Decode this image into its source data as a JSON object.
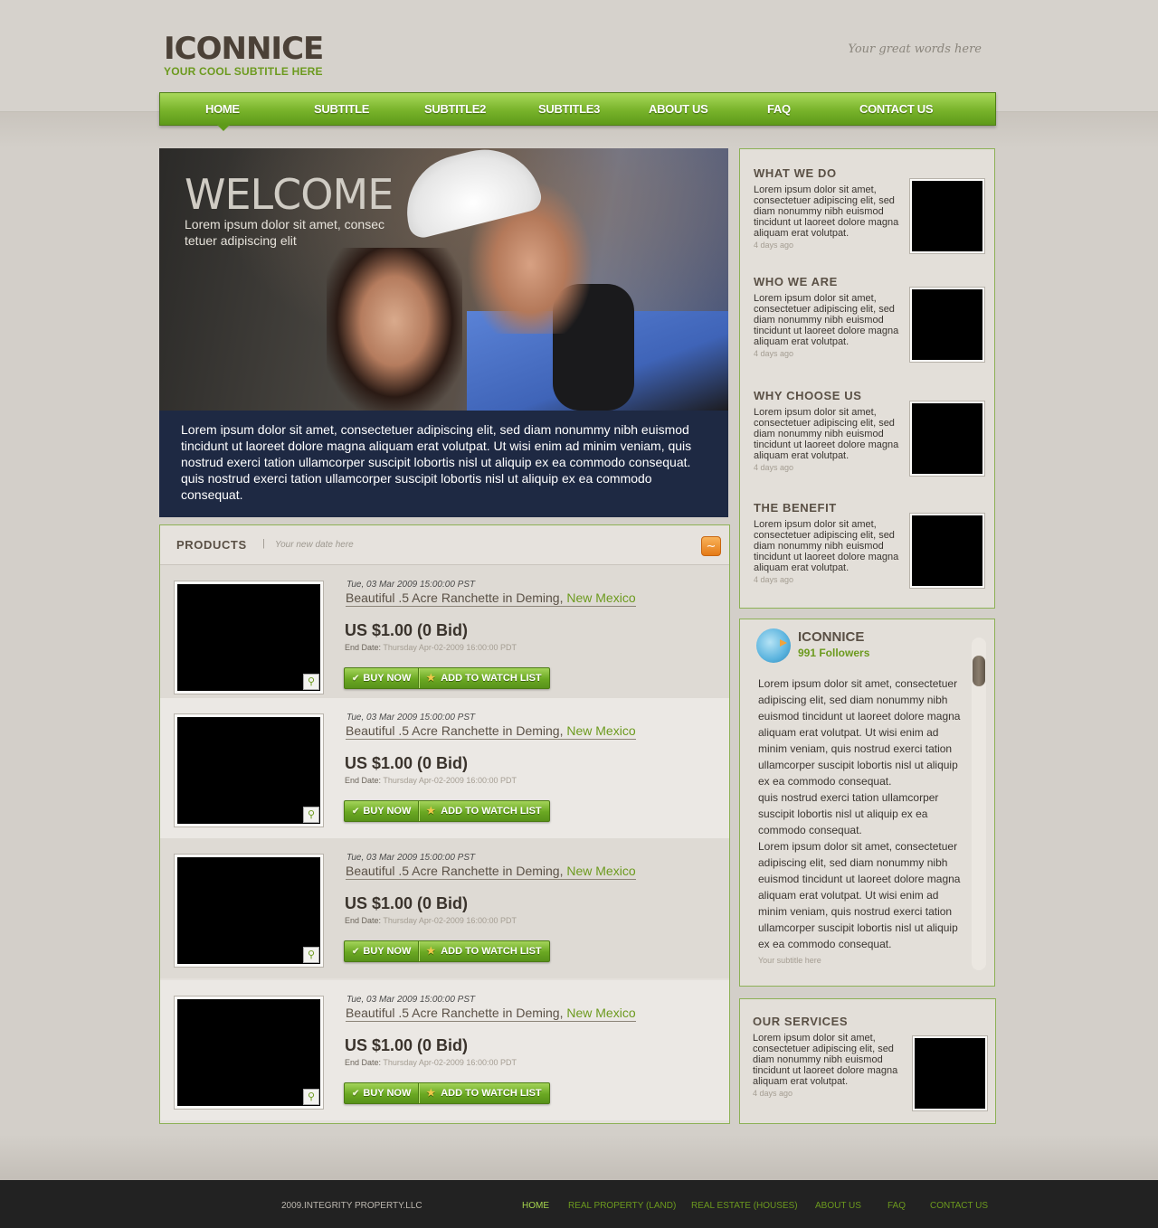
{
  "header": {
    "logo_title": "ICONNICE",
    "logo_subtitle": "YOUR COOL SUBTITLE HERE",
    "tagline": "Your great words here"
  },
  "nav": {
    "items": [
      "HOME",
      "SUBTITLE",
      "SUBTITLE2",
      "SUBTITLE3",
      "ABOUT US",
      "FAQ",
      "CONTACT US"
    ],
    "active": "HOME"
  },
  "hero": {
    "title": "WELCOME",
    "subtitle": "Lorem ipsum dolor sit amet, consec tetuer adipiscing elit",
    "text": "Lorem ipsum dolor sit amet, consectetuer adipiscing elit, sed diam nonummy nibh euismod tincidunt ut laoreet dolore magna aliquam erat volutpat. Ut wisi enim ad minim veniam, quis nostrud exerci tation ullamcorper suscipit lobortis nisl ut aliquip ex ea commodo consequat. quis nostrud exerci tation ullamcorper suscipit lobortis nisl ut aliquip ex ea commodo consequat."
  },
  "products": {
    "title": "PRODUCTS",
    "separator": "|",
    "date_note": "Your new date here",
    "items": [
      {
        "date": "Tue, 03 Mar 2009 15:00:00 PST",
        "title": "Beautiful .5 Acre Ranchette in Deming,",
        "location": "New Mexico",
        "price": "US $1.00 (0 Bid)",
        "end_label": "End Date:",
        "end_value": "Thursday Apr-02-2009 16:00:00 PDT",
        "buy": "BUY NOW",
        "watch": "ADD TO WATCH LIST"
      },
      {
        "date": "Tue, 03 Mar 2009 15:00:00 PST",
        "title": "Beautiful .5 Acre Ranchette in Deming,",
        "location": "New Mexico",
        "price": "US $1.00 (0 Bid)",
        "end_label": "End Date:",
        "end_value": "Thursday Apr-02-2009 16:00:00 PDT",
        "buy": "BUY NOW",
        "watch": "ADD TO WATCH LIST"
      },
      {
        "date": "Tue, 03 Mar 2009 15:00:00 PST",
        "title": "Beautiful .5 Acre Ranchette in Deming,",
        "location": "New Mexico",
        "price": "US $1.00 (0 Bid)",
        "end_label": "End Date:",
        "end_value": "Thursday Apr-02-2009 16:00:00 PDT",
        "buy": "BUY NOW",
        "watch": "ADD TO WATCH LIST"
      },
      {
        "date": "Tue, 03 Mar 2009 15:00:00 PST",
        "title": "Beautiful .5 Acre Ranchette in Deming,",
        "location": "New Mexico",
        "price": "US $1.00 (0 Bid)",
        "end_label": "End Date:",
        "end_value": "Thursday Apr-02-2009 16:00:00 PDT",
        "buy": "BUY NOW",
        "watch": "ADD TO WATCH LIST"
      }
    ]
  },
  "sidebar": {
    "sections": [
      {
        "title": "WHAT WE DO",
        "text": "Lorem ipsum dolor sit amet, consectetuer adipiscing elit, sed diam nonummy nibh euismod tincidunt ut laoreet dolore magna aliquam erat volutpat.",
        "age": "4 days ago"
      },
      {
        "title": "WHO WE ARE",
        "text": "Lorem ipsum dolor sit amet, consectetuer adipiscing elit, sed diam nonummy nibh euismod tincidunt ut laoreet dolore magna aliquam erat volutpat.",
        "age": "4 days ago"
      },
      {
        "title": "WHY CHOOSE US",
        "text": "Lorem ipsum dolor sit amet, consectetuer adipiscing elit, sed diam nonummy nibh euismod tincidunt ut laoreet dolore magna aliquam erat volutpat.",
        "age": "4 days ago"
      },
      {
        "title": "THE BENEFIT",
        "text": "Lorem ipsum dolor sit amet, consectetuer adipiscing elit, sed diam nonummy nibh euismod tincidunt ut laoreet dolore magna aliquam erat volutpat.",
        "age": "4 days ago"
      }
    ],
    "twitter": {
      "name": "ICONNICE",
      "followers": "991 Followers",
      "text1": "Lorem ipsum dolor sit amet, consectetuer adipiscing elit, sed diam nonummy nibh euismod tincidunt ut laoreet dolore magna aliquam erat volutpat. Ut wisi enim ad minim veniam, quis nostrud exerci tation ullamcorper suscipit lobortis nisl ut aliquip ex ea commodo consequat.",
      "text2": "quis nostrud exerci tation ullamcorper suscipit lobortis nisl ut aliquip ex ea commodo consequat.",
      "text3": "Lorem ipsum dolor sit amet, consectetuer adipiscing elit, sed diam nonummy nibh euismod tincidunt ut laoreet dolore magna aliquam erat volutpat. Ut wisi enim ad minim veniam, quis nostrud exerci tation ullamcorper suscipit lobortis nisl ut aliquip ex ea commodo consequat.",
      "footer": "Your subtitle here"
    },
    "services": {
      "title": "OUR SERVICES",
      "text": "Lorem ipsum dolor sit amet, consectetuer adipiscing elit, sed diam nonummy nibh euismod tincidunt ut laoreet dolore magna aliquam erat volutpat.",
      "age": "4 days ago"
    }
  },
  "footer": {
    "copyright": "2009.INTEGRITY PROPERTY.LLC",
    "links": [
      "HOME",
      "REAL PROPERTY (LAND)",
      "REAL ESTATE (HOUSES)",
      "ABOUT US",
      "FAQ",
      "CONTACT US"
    ]
  },
  "icons": {
    "rss": "rss-icon",
    "zoom": "magnifier-icon",
    "check": "check-icon",
    "star": "star-icon",
    "twitter": "twitter-bird-icon"
  },
  "colors": {
    "accent_green": "#6c9a1e",
    "nav_green": "#78b32a",
    "background": "#d3cfc9",
    "hero_panel": "#1e2943",
    "footer": "#222222"
  }
}
